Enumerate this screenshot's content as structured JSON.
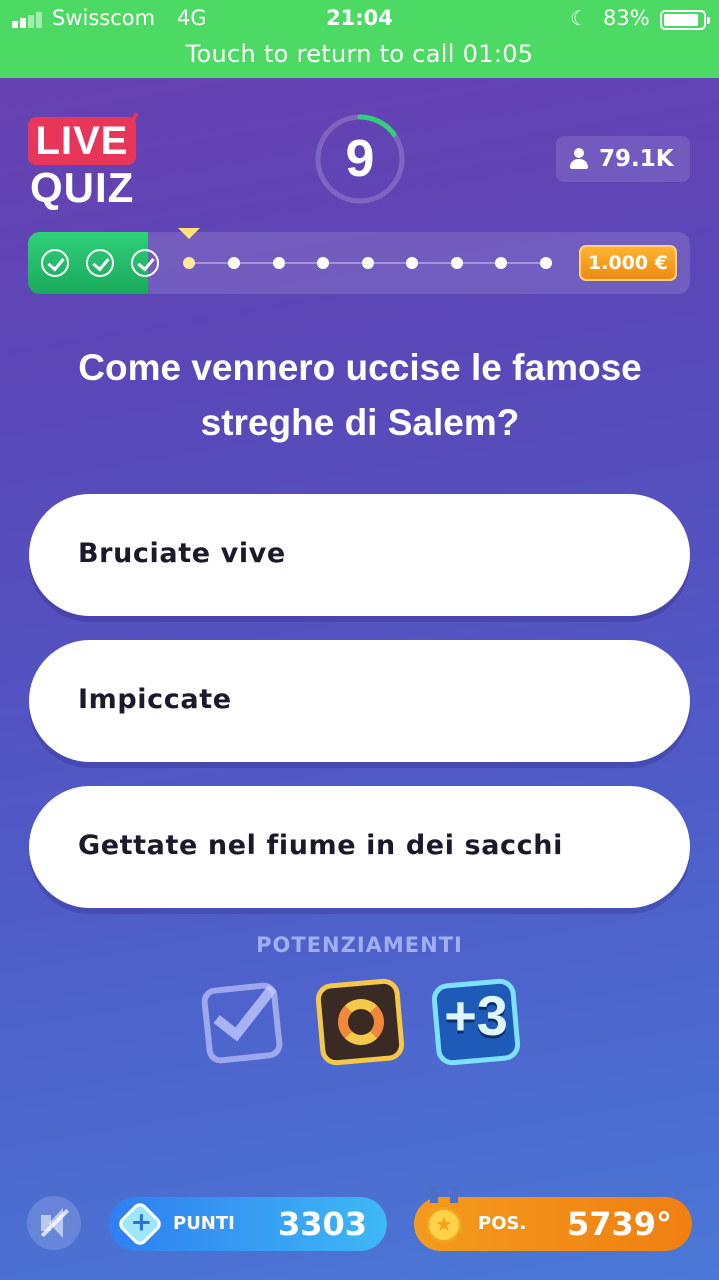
{
  "status_bar": {
    "carrier": "Swisscom",
    "network": "4G",
    "time": "21:04",
    "battery": "83%",
    "call_banner": "Touch to return to call 01:05"
  },
  "header": {
    "logo_live": "LIVE",
    "logo_quiz": "QUIZ",
    "timer": "9",
    "timer_progress": 0.15,
    "viewers": "79.1K"
  },
  "progress": {
    "completed": 3,
    "total": 12,
    "prize": "1.000 €"
  },
  "question": {
    "text": "Come vennero uccise le famose streghe di Salem?",
    "answers": [
      "Bruciate vive",
      "Impiccate",
      "Gettate nel fiume in dei sacchi"
    ]
  },
  "powerups": {
    "title": "POTENZIAMENTI",
    "items": [
      "check-icon",
      "swap-icon",
      "plus-three-icon"
    ],
    "plus3_label": "+3"
  },
  "footer": {
    "points_label": "PUNTI",
    "points_value": "3303",
    "position_label": "POS.",
    "position_value": "5739°"
  },
  "colors": {
    "status_green": "#4cd964",
    "live_red": "#e8365a",
    "progress_green": "#1aa95c",
    "prize_orange": "#f08a12",
    "points_blue": "#2f7ff2",
    "position_orange": "#f39b1c"
  }
}
